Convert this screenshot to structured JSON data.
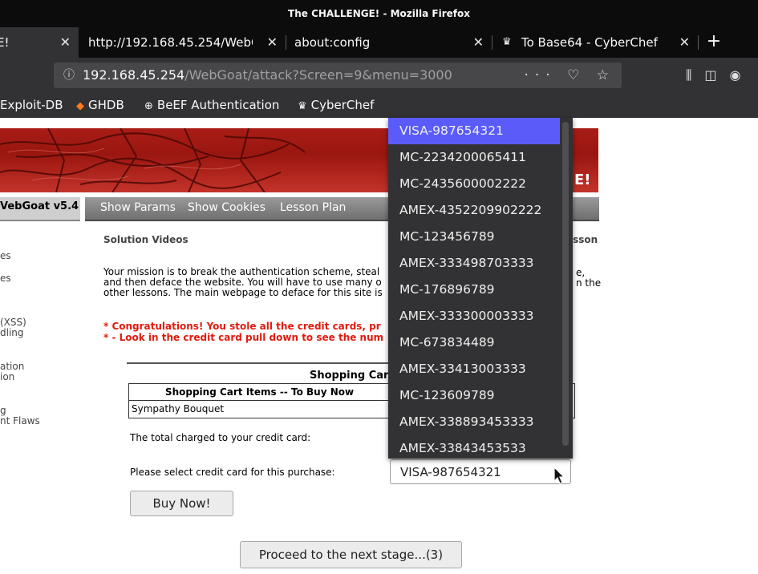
{
  "window": {
    "title": "The CHALLENGE! - Mozilla Firefox"
  },
  "tabs": [
    {
      "label": "E!",
      "active": true
    },
    {
      "label": "http://192.168.45.254/WebG",
      "active": false
    },
    {
      "label": "about:config",
      "active": false
    },
    {
      "label": "To Base64 - CyberChef",
      "active": false
    }
  ],
  "urlbar": {
    "host": "192.168.45.254",
    "path": "/WebGoat/attack?Screen=9&menu=3000",
    "actions": "··· ♡ ☆"
  },
  "bookmarks": [
    {
      "label": "Exploit-DB",
      "icon": "none"
    },
    {
      "label": "GHDB",
      "icon": "ghdb-icon"
    },
    {
      "label": "BeEF Authentication",
      "icon": "globe-icon"
    },
    {
      "label": "CyberChef",
      "icon": "chef-hat-icon"
    }
  ],
  "header": {
    "version_label": "VebGoat  v5.4",
    "banner_text": "E!",
    "menu": [
      "Show Params",
      "Show Cookies",
      "Lesson Plan"
    ]
  },
  "sidebar": {
    "fragments": [
      "es",
      "es",
      "(XSS)",
      "dling",
      "ation",
      "ion",
      "g",
      "nt Flaws"
    ]
  },
  "main": {
    "subhead": "Solution Videos",
    "lesson_link": "esson",
    "mission_lines": [
      "Your mission is to break the authentication scheme, steal",
      "and then deface the website. You will have to use many o",
      "other lessons. The main webpage to deface for this site is"
    ],
    "mission_tail": [
      "e,",
      "n the"
    ],
    "congrats_lines": [
      "* Congratulations! You stole all the credit cards, pr",
      "* - Look in the credit card pull down to see the num"
    ],
    "cart": {
      "title": "Shopping Car",
      "header": "Shopping Cart Items -- To Buy Now",
      "item": "Sympathy Bouquet"
    },
    "total_label": "The total charged to your credit card:",
    "select_label": "Please select credit card for this purchase:",
    "selected_card": "VISA-987654321",
    "buy_button": "Buy Now!",
    "proceed_button": "Proceed to the next stage...(3)"
  },
  "dropdown": {
    "options": [
      "VISA-987654321",
      "MC-2234200065411",
      "MC-2435600002222",
      "AMEX-4352209902222",
      "MC-123456789",
      "AMEX-333498703333",
      "MC-176896789",
      "AMEX-333300003333",
      "MC-673834489",
      "AMEX-33413003333",
      "MC-123609789",
      "AMEX-338893453333",
      "AMEX-33843453533"
    ],
    "selected_index": 0
  },
  "colors": {
    "selection": "#5b5bfa",
    "congrats": "#e21b0f",
    "chrome_dark": "#0c0c0d",
    "chrome_mid": "#323234"
  }
}
